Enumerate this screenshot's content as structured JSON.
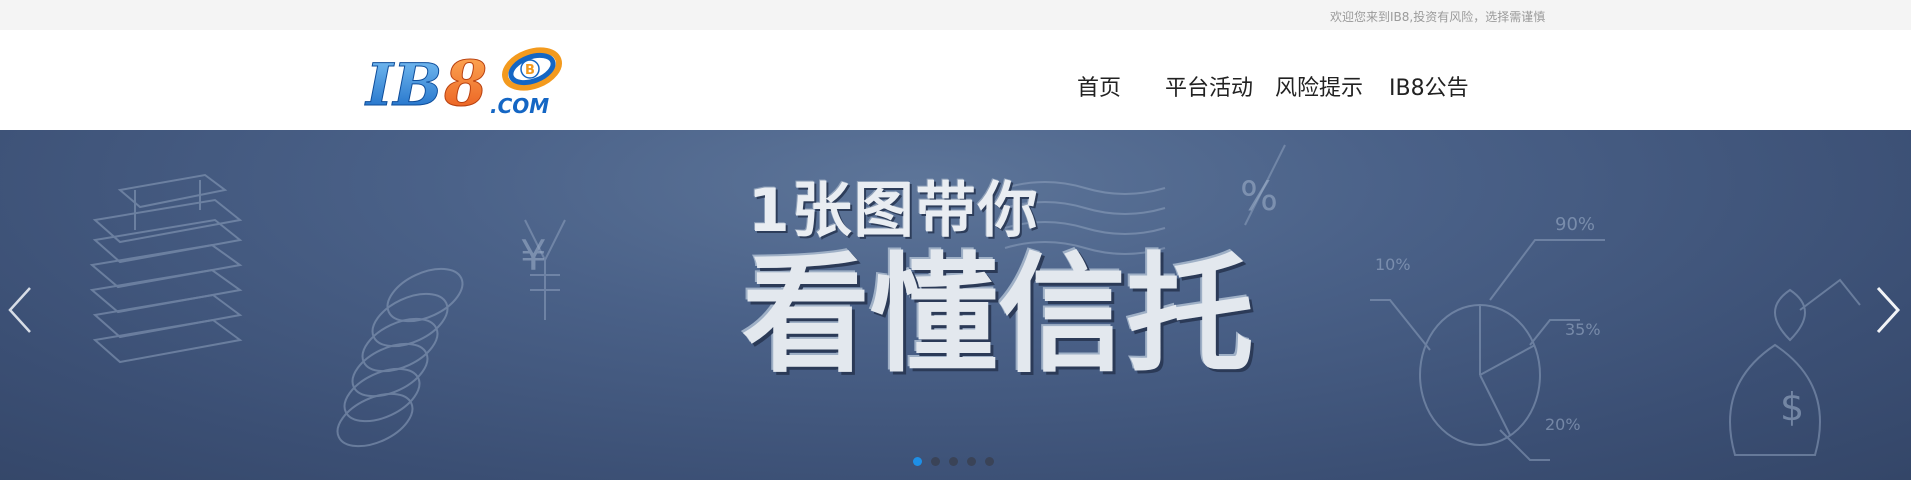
{
  "topbar": {
    "welcome_text": "欢迎您来到IB8,投资有风险，选择需谨慎"
  },
  "logo": {
    "main": "IB8",
    "suffix": ".COM",
    "badge": "B"
  },
  "nav": {
    "items": [
      {
        "label": "首页"
      },
      {
        "label": "平台活动"
      },
      {
        "label": "风险提示"
      },
      {
        "label": "IB8公告"
      }
    ]
  },
  "banner": {
    "headline_line1": "1张图带你",
    "headline_line2": "看懂信托",
    "chalk_labels": [
      "%",
      "10%",
      "90%",
      "35%",
      "20%",
      "$",
      "¥"
    ],
    "background_color": "#4a6188",
    "slide_count": 5,
    "active_slide": 1
  },
  "colors": {
    "active_dot": "#1e8fe6",
    "inactive_dot": "#3a4357",
    "topbar_bg": "#f4f4f4"
  },
  "icons": [
    "arrow-left-icon",
    "arrow-right-icon"
  ]
}
